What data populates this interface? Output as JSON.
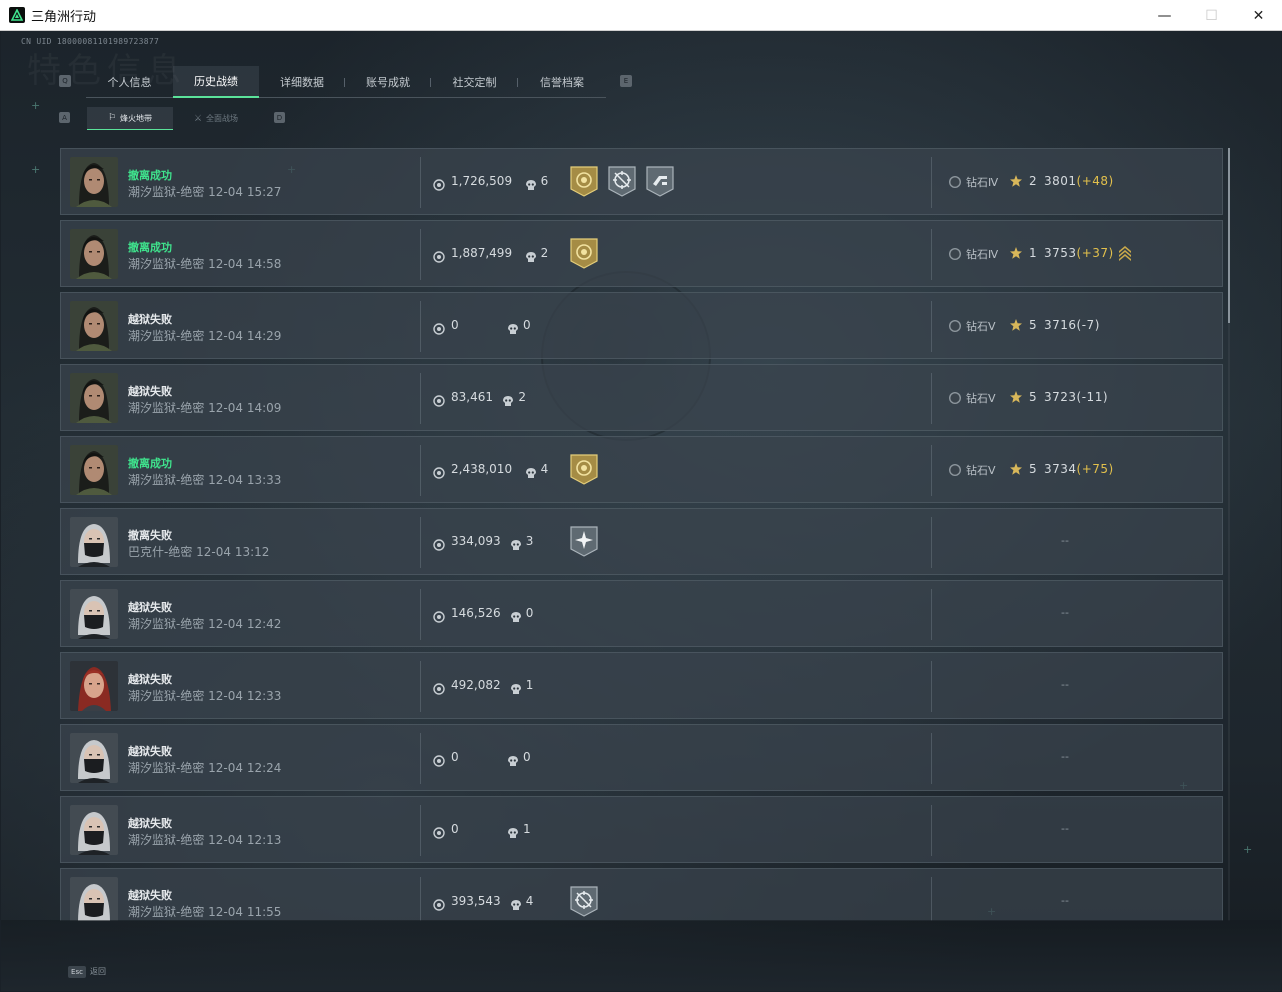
{
  "window": {
    "title": "三角洲行动",
    "minimize": "—",
    "maximize": "☐",
    "close": "✕"
  },
  "header": {
    "uid": "CN UID 18000081101989723877",
    "watermark": "特色信息",
    "tabs": [
      {
        "label": "个人信息",
        "active": false
      },
      {
        "label": "历史战绩",
        "active": true
      },
      {
        "label": "详细数据",
        "active": false
      },
      {
        "label": "账号成就",
        "active": false
      },
      {
        "label": "社交定制",
        "active": false
      },
      {
        "label": "信誉档案",
        "active": false
      }
    ],
    "tab_key_left": "Q",
    "tab_key_right": "E",
    "subtabs": [
      {
        "label": "烽火地带",
        "active": true,
        "glyph": "⚐"
      },
      {
        "label": "全面战场",
        "active": false,
        "glyph": "⚔"
      }
    ],
    "subtab_key_left": "A",
    "subtab_key_right": "D"
  },
  "colors": {
    "success": "#3fe38d",
    "accent_green": "#5be39a",
    "delta_positive": "#e2c04c",
    "gold_medal": "#b49b52",
    "gray_medal": "#6b757d"
  },
  "matches": [
    {
      "result": "撤离成功",
      "success": true,
      "map": "潮汐监狱-绝密 12-04 15:27",
      "avatar": "female-dark-hair",
      "value": "1,726,509",
      "kills": "6",
      "medals": [
        "gold-target-medal",
        "crosshair-medal",
        "weapon-medal"
      ],
      "rank_icon": "Ⅳ",
      "rank": "钻石Ⅳ",
      "stars": "2",
      "score": "3801",
      "delta": "(+48)",
      "delta_positive": true,
      "promote": false
    },
    {
      "result": "撤离成功",
      "success": true,
      "map": "潮汐监狱-绝密 12-04 14:58",
      "avatar": "female-dark-hair",
      "value": "1,887,499",
      "kills": "2",
      "medals": [
        "gold-target-medal"
      ],
      "rank_icon": "Ⅳ",
      "rank": "钻石Ⅳ",
      "stars": "1",
      "score": "3753",
      "delta": "(+37)",
      "delta_positive": true,
      "promote": true
    },
    {
      "result": "越狱失败",
      "success": false,
      "map": "潮汐监狱-绝密 12-04 14:29",
      "avatar": "female-dark-hair",
      "value": "0",
      "kills": "0",
      "medals": [],
      "rank_icon": "Ⅴ",
      "rank": "钻石Ⅴ",
      "stars": "5",
      "score": "3716",
      "delta": "(-7)",
      "delta_positive": false,
      "promote": false
    },
    {
      "result": "越狱失败",
      "success": false,
      "map": "潮汐监狱-绝密 12-04 14:09",
      "avatar": "female-dark-hair",
      "value": "83,461",
      "kills": "2",
      "medals": [],
      "rank_icon": "Ⅴ",
      "rank": "钻石Ⅴ",
      "stars": "5",
      "score": "3723",
      "delta": "(-11)",
      "delta_positive": false,
      "promote": false
    },
    {
      "result": "撤离成功",
      "success": true,
      "map": "潮汐监狱-绝密 12-04 13:33",
      "avatar": "female-dark-hair",
      "value": "2,438,010",
      "kills": "4",
      "medals": [
        "gold-target-medal"
      ],
      "rank_icon": "Ⅴ",
      "rank": "钻石Ⅴ",
      "stars": "5",
      "score": "3734",
      "delta": "(+75)",
      "delta_positive": true,
      "promote": false
    },
    {
      "result": "撤离失败",
      "success": false,
      "map": "巴克什-绝密 12-04 13:12",
      "avatar": "masked-white-hair",
      "value": "334,093",
      "kills": "3",
      "medals": [
        "gray-star-medal"
      ],
      "rank": null,
      "dash": "--"
    },
    {
      "result": "越狱失败",
      "success": false,
      "map": "潮汐监狱-绝密 12-04 12:42",
      "avatar": "masked-white-hair",
      "value": "146,526",
      "kills": "0",
      "medals": [],
      "rank": null,
      "dash": "--"
    },
    {
      "result": "越狱失败",
      "success": false,
      "map": "潮汐监狱-绝密 12-04 12:33",
      "avatar": "female-red-hair",
      "value": "492,082",
      "kills": "1",
      "medals": [],
      "rank": null,
      "dash": "--"
    },
    {
      "result": "越狱失败",
      "success": false,
      "map": "潮汐监狱-绝密 12-04 12:24",
      "avatar": "masked-white-hair",
      "value": "0",
      "kills": "0",
      "medals": [],
      "rank": null,
      "dash": "--"
    },
    {
      "result": "越狱失败",
      "success": false,
      "map": "潮汐监狱-绝密 12-04 12:13",
      "avatar": "masked-white-hair",
      "value": "0",
      "kills": "1",
      "medals": [],
      "rank": null,
      "dash": "--"
    },
    {
      "result": "越狱失败",
      "success": false,
      "map": "潮汐监狱-绝密 12-04 11:55",
      "avatar": "masked-white-hair",
      "value": "393,543",
      "kills": "4",
      "medals": [
        "gray-crosshair-medal"
      ],
      "rank": null,
      "dash": "--"
    }
  ],
  "footer": {
    "esc_key": "Esc",
    "esc_label": "返回"
  }
}
